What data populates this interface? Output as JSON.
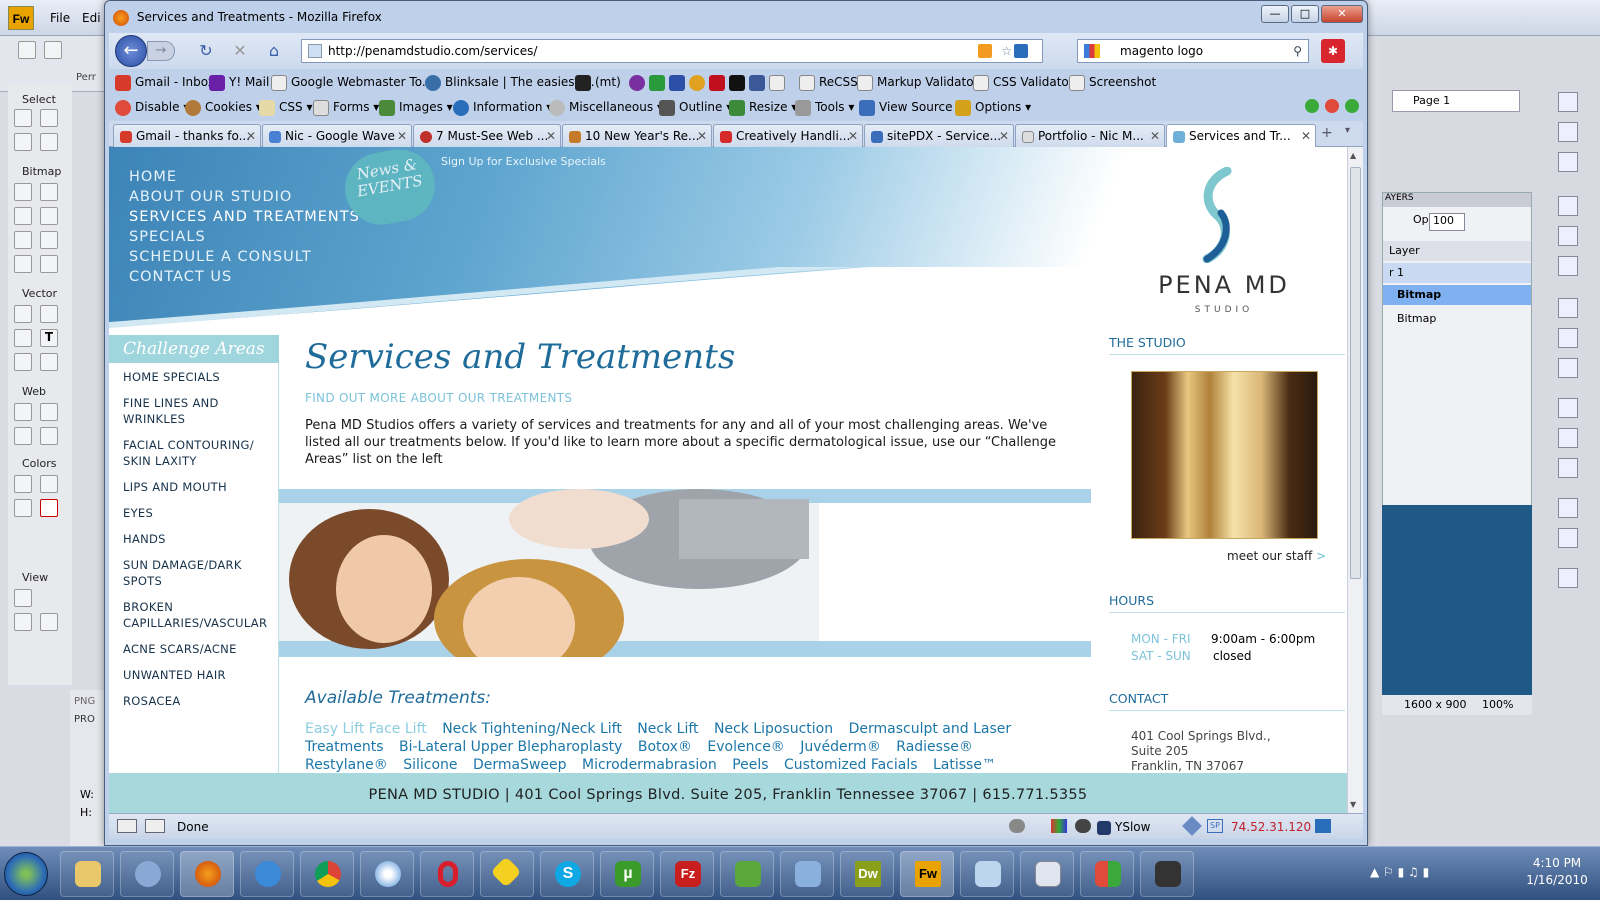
{
  "fireworks": {
    "logo": "Fw",
    "menu": [
      "File",
      "Edi"
    ],
    "tool_sections": [
      "Select",
      "Bitmap",
      "Vector",
      "Web",
      "Colors",
      "View"
    ],
    "page_label": "Page 1",
    "layers_tab": "AYERS",
    "opacity_label": "Opacity",
    "opacity_value": "100",
    "layers": [
      "Layer",
      "r 1",
      "Bitmap",
      "Bitmap"
    ],
    "canvas_size": "1600 x 900",
    "zoom": "100%",
    "left_labels": [
      "Perr",
      "PNG",
      "PRO",
      "W:",
      "H:",
      "Se",
      "Bi",
      "Ve",
      "W",
      "Co"
    ]
  },
  "firefox": {
    "title": "Services and Treatments - Mozilla Firefox",
    "url": "http://penamdstudio.com/services/",
    "search": "magento logo",
    "bookmarks": [
      "Gmail - Inbox",
      "Y! Mail",
      "Google Webmaster To...",
      "Blinksale | The easiest ...",
      "(mt)",
      "ReCSS",
      "Markup Validator",
      "CSS Validator",
      "Screenshot"
    ],
    "webdev": [
      "Disable",
      "Cookies",
      "CSS",
      "Forms",
      "Images",
      "Information",
      "Miscellaneous",
      "Outline",
      "Resize",
      "Tools",
      "View Source",
      "Options"
    ],
    "tabs": [
      "Gmail - thanks fo...",
      "Nic - Google Wave",
      "7 Must-See Web ...",
      "10 New Year's Re...",
      "Creatively Handli...",
      "sitePDX - Service...",
      "Portfolio - Nic M...",
      "Services and Tr..."
    ],
    "status": "Done",
    "yslow": "YSlow",
    "ip": "74.52.31.120"
  },
  "page": {
    "nav": [
      "HOME",
      "ABOUT OUR STUDIO",
      "SERVICES AND TREATMENTS",
      "SPECIALS",
      "SCHEDULE A CONSULT",
      "CONTACT US"
    ],
    "badge_line1": "News &",
    "badge_line2": "EVENTS",
    "signup": "Sign Up for Exclusive Specials",
    "sidebar_title": "Challenge Areas",
    "sidebar": [
      "HOME SPECIALS",
      "FINE LINES AND WRINKLES",
      "FACIAL CONTOURING/ SKIN LAXITY",
      "LIPS AND MOUTH",
      "EYES",
      "HANDS",
      "SUN DAMAGE/DARK SPOTS",
      "BROKEN CAPILLARIES/VASCULAR",
      "ACNE SCARS/ACNE",
      "UNWANTED HAIR",
      "ROSACEA"
    ],
    "title": "Services and Treatments",
    "subtitle": "FIND OUT MORE ABOUT OUR TREATMENTS",
    "intro": "Pena MD Studios offers a variety of services and treatments for any and all of your most challenging areas. We've listed all our treatments below. If you'd like to learn more about a specific dermatological issue, use our “Challenge Areas” list on the left",
    "available_title": "Available Treatments:",
    "treatments": [
      "Easy Lift Face Lift",
      "Neck Tightening/Neck Lift",
      "Neck Lift",
      "Neck Liposuction",
      "Dermasculpt and Laser Treatments",
      "Bi-Lateral Upper Blepharoplasty",
      "Botox®",
      "Evolence®",
      "Juvéderm®",
      "Radiesse®",
      "Restylane®",
      "Silicone",
      "DermaSweep",
      "Microdermabrasion",
      "Peels",
      "Customized Facials",
      "Latisse™ Eyelash"
    ],
    "logo_name": "PENA MD",
    "logo_sub": "STUDIO",
    "studio_head": "THE STUDIO",
    "meet_staff": "meet our staff",
    "meet_arrow": ">",
    "hours_head": "HOURS",
    "hours": [
      {
        "days": "MON - FRI",
        "time": "9:00am - 6:00pm"
      },
      {
        "days": "SAT - SUN",
        "time": "closed"
      }
    ],
    "contact_head": "CONTACT",
    "address": [
      "401 Cool Springs Blvd.,",
      "Suite 205",
      "Franklin, TN 37067"
    ],
    "footer": "PENA MD STUDIO | 401 Cool Springs Blvd. Suite 205, Franklin Tennessee 37067 | 615.771.5355"
  },
  "taskbar": {
    "time": "4:10 PM",
    "date": "1/16/2010",
    "apps": [
      "explorer",
      "outlook",
      "firefox",
      "ie",
      "chrome",
      "safari",
      "opera",
      "ie-tester",
      "skype",
      "utorrent",
      "filezilla",
      "evernote",
      "notepad",
      "dreamweaver",
      "fireworks",
      "windows",
      "calculator",
      "games",
      "camera"
    ],
    "labels": {
      "dreamweaver": "Dw",
      "fireworks": "Fw",
      "filezilla": "Fz",
      "utorrent": "µ"
    }
  },
  "colors": {
    "accent": "#1f6b9a",
    "teal": "#a6d8dc",
    "link": "#1c77a8"
  }
}
